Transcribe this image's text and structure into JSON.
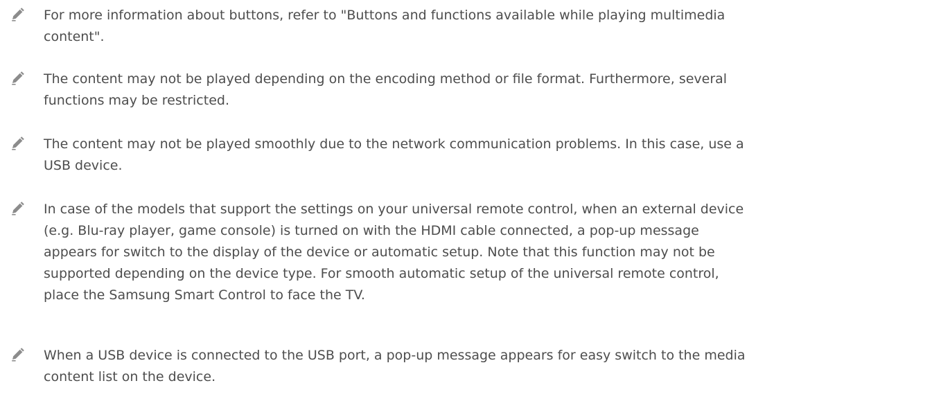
{
  "notes": [
    {
      "icon": "pencil-icon",
      "text": "For more information about buttons, refer to \"Buttons and functions available while playing multimedia content\"."
    },
    {
      "icon": "pencil-icon",
      "text": "The content may not be played depending on the encoding method or file format. Furthermore, several functions may be restricted."
    },
    {
      "icon": "pencil-icon",
      "text": "The content may not be played smoothly due to the network communication problems. In this case, use a USB device."
    },
    {
      "icon": "pencil-icon",
      "text": "In case of the models that support the settings on your universal remote control, when an external device (e.g. Blu-ray player, game console) is turned on with the HDMI cable connected, a pop-up message appears for switch to the display of the device or automatic setup. Note that this function may not be supported depending on the device type. For smooth automatic setup of the universal remote control, place the Samsung Smart Control to face the TV."
    },
    {
      "icon": "pencil-icon",
      "text": "When a USB device is connected to the USB port, a pop-up message appears for easy switch to the media content list on the device."
    }
  ],
  "colors": {
    "text": "#4d4d4d",
    "icon": "#8c8c8c"
  }
}
